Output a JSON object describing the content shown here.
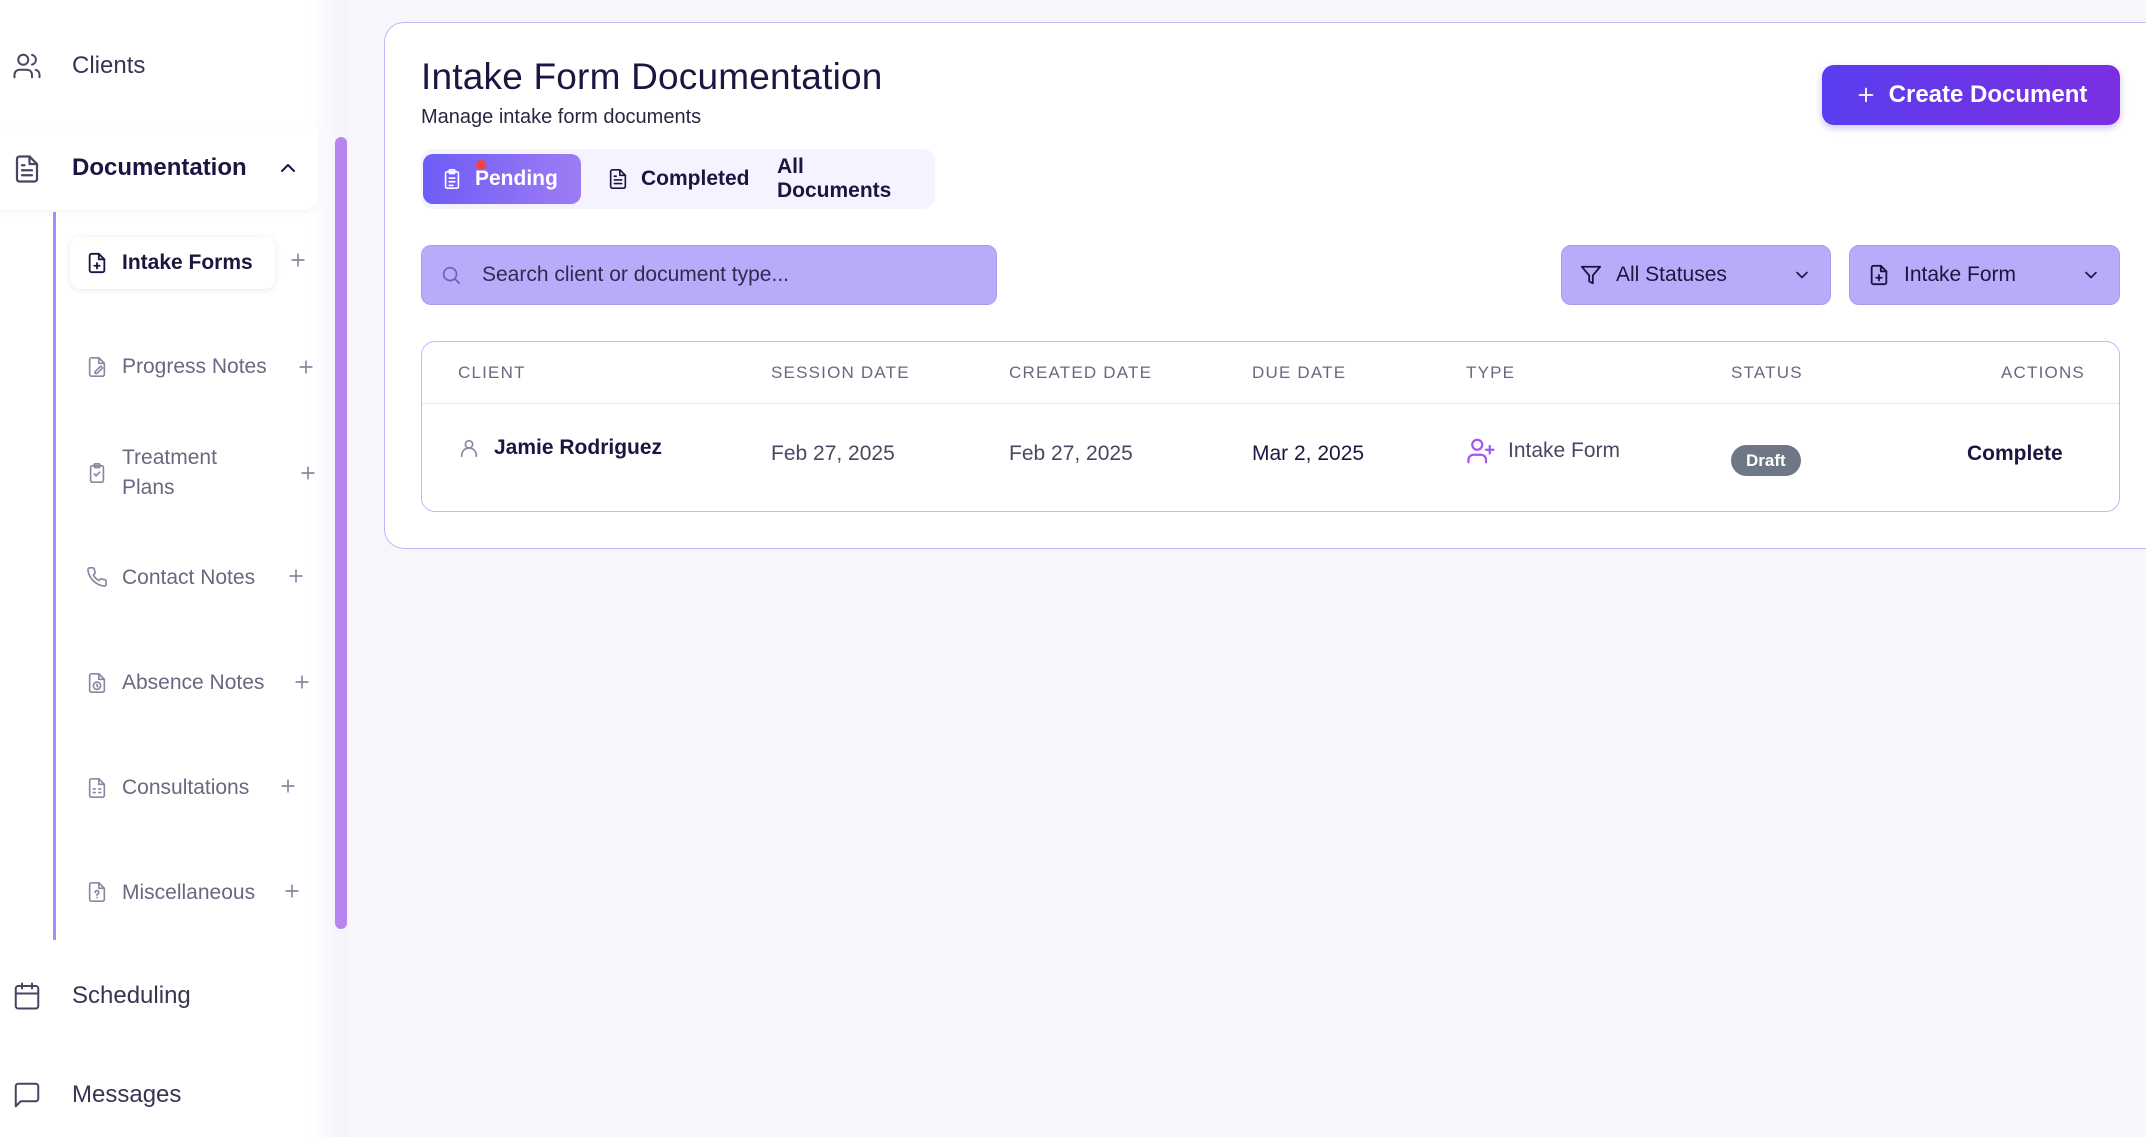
{
  "sidebar": {
    "clients_label": "Clients",
    "documentation_label": "Documentation",
    "scheduling_label": "Scheduling",
    "messages_label": "Messages",
    "sub_items": [
      {
        "label": "Intake Forms",
        "icon": "file-plus-icon"
      },
      {
        "label": "Progress Notes",
        "icon": "file-edit-icon"
      },
      {
        "label": "Treatment Plans",
        "icon": "clipboard-icon"
      },
      {
        "label": "Contact Notes",
        "icon": "phone-icon"
      },
      {
        "label": "Absence Notes",
        "icon": "file-clock-icon"
      },
      {
        "label": "Consultations",
        "icon": "file-spreadsheet-icon"
      },
      {
        "label": "Miscellaneous",
        "icon": "file-question-icon"
      }
    ]
  },
  "header": {
    "title": "Intake Form Documentation",
    "subtitle": "Manage intake form documents",
    "create_button": "Create Document"
  },
  "tabs": {
    "pending": "Pending",
    "completed": "Completed",
    "all": "All Documents"
  },
  "search": {
    "placeholder": "Search client or document type..."
  },
  "filters": {
    "status": "All Statuses",
    "type": "Intake Form"
  },
  "table": {
    "columns": {
      "client": "CLIENT",
      "session_date": "SESSION DATE",
      "created_date": "CREATED DATE",
      "due_date": "DUE DATE",
      "type": "TYPE",
      "status": "STATUS",
      "actions": "ACTIONS"
    },
    "rows": [
      {
        "client": "Jamie Rodriguez",
        "session_date": "Feb 27, 2025",
        "created_date": "Feb 27, 2025",
        "due_date": "Mar 2, 2025",
        "type": "Intake Form",
        "status": "Draft",
        "action": "Complete"
      }
    ]
  },
  "colors": {
    "accent": "#5b3df0",
    "accent_secondary": "#7a2fe0",
    "filter_bg": "#b8acfa",
    "card_border": "#c4b5fd",
    "draft_badge": "#6f7786",
    "notification_dot": "#ef4444"
  }
}
